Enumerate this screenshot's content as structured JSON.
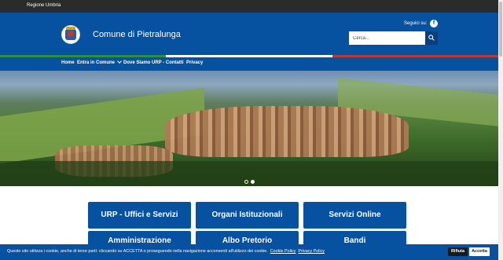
{
  "topbar": {
    "region_link": "Regione Umbria"
  },
  "header": {
    "title": "Comune di Pietralunga",
    "follow_label": "Seguici su:",
    "facebook_glyph": "f",
    "search_placeholder": "Cerca..."
  },
  "tricolor": [
    "#2f8f3a",
    "#ffffff",
    "#c0392b"
  ],
  "nav": {
    "items": [
      {
        "label": "Home"
      },
      {
        "label": "Entra in Comune",
        "has_dropdown": true
      },
      {
        "label": "Dove Siamo"
      },
      {
        "label": "URP - Contatti"
      },
      {
        "label": "Privacy"
      }
    ]
  },
  "carousel": {
    "slide_count": 2,
    "active_slide": 2
  },
  "tiles": {
    "row1": [
      "URP - Uffici e Servizi",
      "Organi Istituzionali",
      "Servizi Online"
    ],
    "row2": [
      "Amministrazione",
      "Albo Pretorio",
      "Bandi"
    ]
  },
  "cookie": {
    "text": "Questo sito utilizza i cookie, anche di terze parti: cliccando su ACCETTA o proseguendo nella navigazione acconsenti all'utilizzo dei cookie.",
    "cookie_policy": "Cookie Policy",
    "privacy_policy": "Privacy Policy",
    "refuse": "Rifiuta",
    "accept": "Accetta"
  },
  "colors": {
    "primary": "#0651a0",
    "topbar": "#2b2b2b"
  }
}
